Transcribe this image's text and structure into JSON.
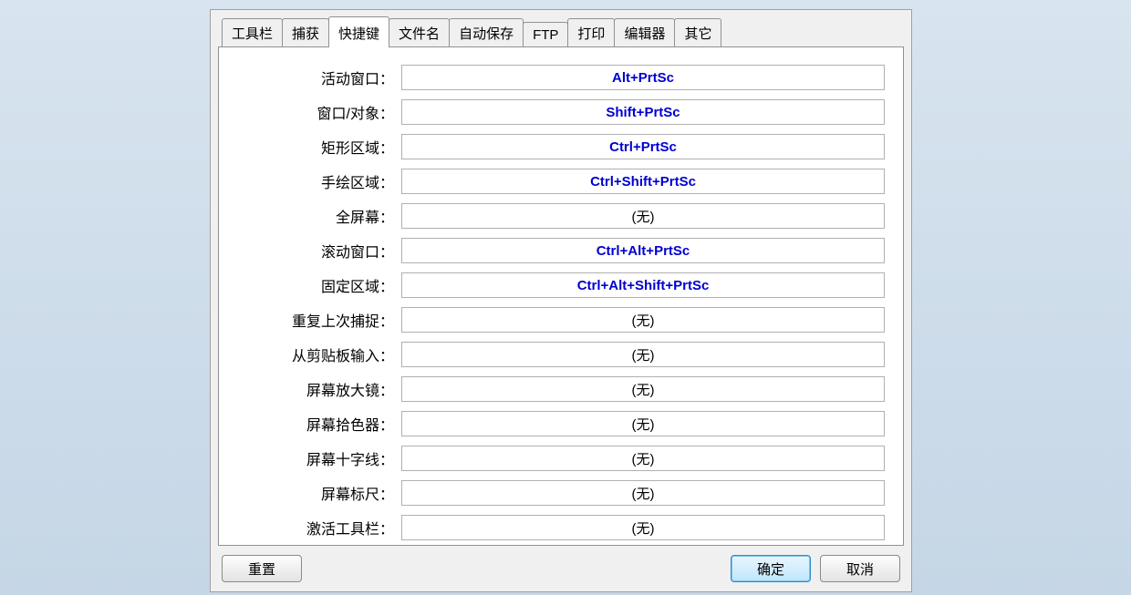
{
  "tabs": [
    {
      "id": "toolbar",
      "label": "工具栏"
    },
    {
      "id": "capture",
      "label": "捕获"
    },
    {
      "id": "hotkey",
      "label": "快捷键"
    },
    {
      "id": "filename",
      "label": "文件名"
    },
    {
      "id": "autosave",
      "label": "自动保存"
    },
    {
      "id": "ftp",
      "label": "FTP"
    },
    {
      "id": "print",
      "label": "打印"
    },
    {
      "id": "editor",
      "label": "编辑器"
    },
    {
      "id": "other",
      "label": "其它"
    }
  ],
  "active_tab": "hotkey",
  "none_text": "(无)",
  "hotkeys": [
    {
      "id": "active-window",
      "label": "活动窗口：",
      "value": "Alt+PrtSc",
      "has_key": true
    },
    {
      "id": "window-object",
      "label": "窗口/对象：",
      "value": "Shift+PrtSc",
      "has_key": true
    },
    {
      "id": "rect-region",
      "label": "矩形区域：",
      "value": "Ctrl+PrtSc",
      "has_key": true
    },
    {
      "id": "freehand-region",
      "label": "手绘区域：",
      "value": "Ctrl+Shift+PrtSc",
      "has_key": true
    },
    {
      "id": "full-screen",
      "label": "全屏幕：",
      "value": "(无)",
      "has_key": false
    },
    {
      "id": "scroll-window",
      "label": "滚动窗口：",
      "value": "Ctrl+Alt+PrtSc",
      "has_key": true
    },
    {
      "id": "fixed-region",
      "label": "固定区域：",
      "value": "Ctrl+Alt+Shift+PrtSc",
      "has_key": true
    },
    {
      "id": "repeat-last",
      "label": "重复上次捕捉：",
      "value": "(无)",
      "has_key": false
    },
    {
      "id": "clipboard-input",
      "label": "从剪贴板输入：",
      "value": "(无)",
      "has_key": false
    },
    {
      "id": "magnifier",
      "label": "屏幕放大镜：",
      "value": "(无)",
      "has_key": false
    },
    {
      "id": "color-picker",
      "label": "屏幕拾色器：",
      "value": "(无)",
      "has_key": false
    },
    {
      "id": "crosshair",
      "label": "屏幕十字线：",
      "value": "(无)",
      "has_key": false
    },
    {
      "id": "ruler",
      "label": "屏幕标尺：",
      "value": "(无)",
      "has_key": false
    },
    {
      "id": "toggle-toolbar",
      "label": "激活工具栏：",
      "value": "(无)",
      "has_key": false
    }
  ],
  "buttons": {
    "reset": "重置",
    "ok": "确定",
    "cancel": "取消"
  }
}
